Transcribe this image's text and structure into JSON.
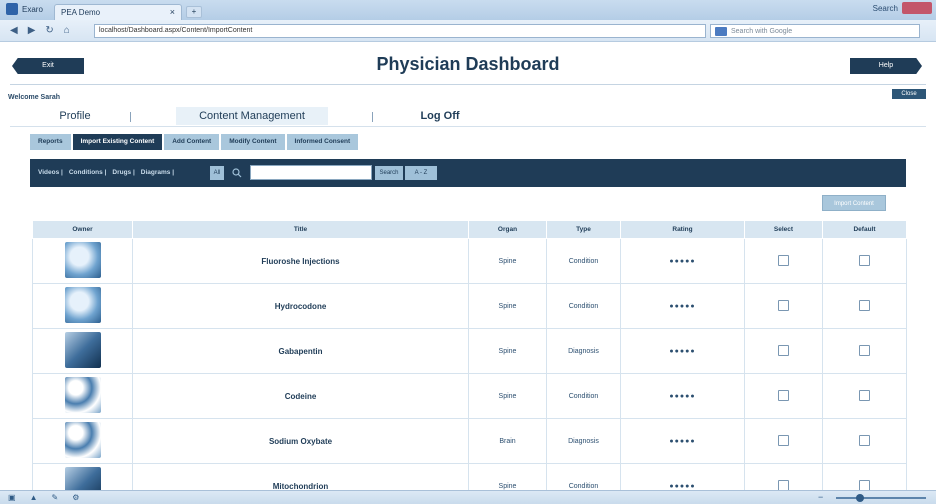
{
  "browser": {
    "app_name": "Exaro",
    "tab_title": "PEA Demo",
    "tab_close": "×",
    "new_tab": "+",
    "address": "localhost/Dashboard.aspx/Content/ImportContent",
    "web_search_placeholder": "Search with Google",
    "window_label": "Search"
  },
  "header": {
    "title": "Physician Dashboard",
    "prev_label": "Exit",
    "next_label": "Help"
  },
  "welcome": "Welcome Sarah",
  "close_label": "Close",
  "main_menu": [
    "Profile",
    "Content Management",
    "Log Off"
  ],
  "sub_tabs": [
    {
      "label": "Reports",
      "active": false
    },
    {
      "label": "Import Existing Content",
      "active": true
    },
    {
      "label": "Add Content",
      "active": false
    },
    {
      "label": "Modify Content",
      "active": false
    },
    {
      "label": "Informed Consent",
      "active": false
    }
  ],
  "filters": {
    "links": [
      "Videos |",
      "Conditions |",
      "Drugs |",
      "Diagrams |"
    ],
    "all_label": "All",
    "search_value": "",
    "search_label": "Search",
    "az_label": "A - Z"
  },
  "import_label": "Import Content",
  "table": {
    "headers": [
      "Owner",
      "Title",
      "Organ",
      "Type",
      "Rating",
      "Select",
      "Default"
    ],
    "rows": [
      {
        "thumb": "hands",
        "title": "Fluoroshe Injections",
        "organ": "Spine",
        "type": "Condition",
        "rating": "●●●●●"
      },
      {
        "thumb": "hands",
        "title": "Hydrocodone",
        "organ": "Spine",
        "type": "Condition",
        "rating": "●●●●●"
      },
      {
        "thumb": "doctor",
        "title": "Gabapentin",
        "organ": "Spine",
        "type": "Diagnosis",
        "rating": "●●●●●"
      },
      {
        "thumb": "people",
        "title": "Codeine",
        "organ": "Spine",
        "type": "Condition",
        "rating": "●●●●●"
      },
      {
        "thumb": "people",
        "title": "Sodium Oxybate",
        "organ": "Brain",
        "type": "Diagnosis",
        "rating": "●●●●●"
      },
      {
        "thumb": "doctor",
        "title": "Mitochondrion",
        "organ": "Spine",
        "type": "Condition",
        "rating": "●●●●●"
      }
    ]
  },
  "icons": {
    "back": "back-arrow-icon",
    "forward": "forward-arrow-icon",
    "refresh": "refresh-icon",
    "home": "home-icon",
    "search": "search-icon"
  },
  "colors": {
    "primary_dark": "#1f3c57",
    "accent_light": "#a9c7dc",
    "table_header": "#d8e6f1"
  }
}
